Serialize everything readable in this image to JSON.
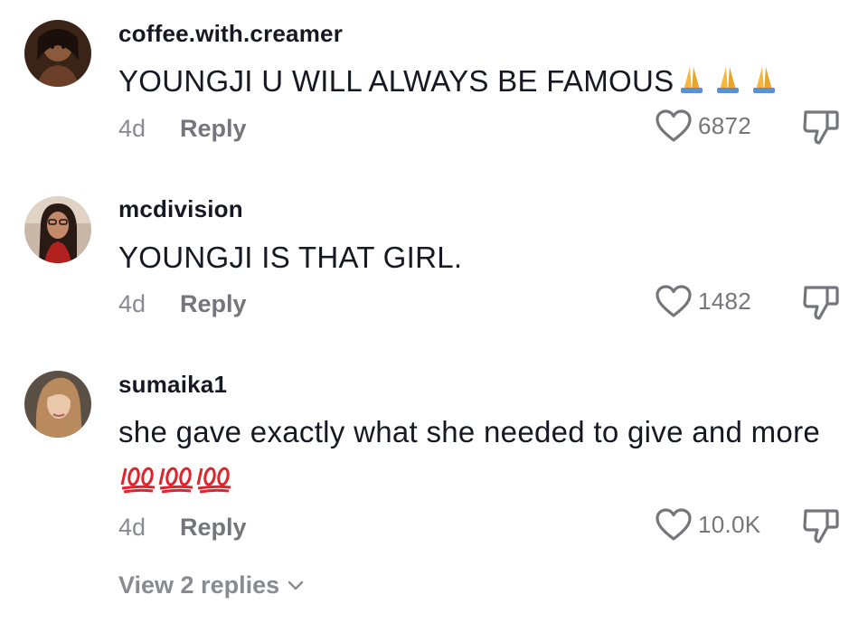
{
  "comments": [
    {
      "username": "coffee.with.creamer",
      "text": "YOUNGJI U WILL ALWAYS BE FAMOUS",
      "emoji": "folded-hands x3",
      "age": "4d",
      "reply_label": "Reply",
      "likes": "6872"
    },
    {
      "username": "mcdivision",
      "text": "YOUNGJI IS THAT GIRL.",
      "age": "4d",
      "reply_label": "Reply",
      "likes": "1482"
    },
    {
      "username": "sumaika1",
      "text": "she gave exactly what she needed to give and more",
      "emoji": "hundred-points x3",
      "age": "4d",
      "reply_label": "Reply",
      "likes": "10.0K"
    }
  ],
  "view_replies_label": "View 2 replies",
  "colors": {
    "primary_text": "#161823",
    "secondary_text": "#8a8b91",
    "icon": "#75767b"
  }
}
